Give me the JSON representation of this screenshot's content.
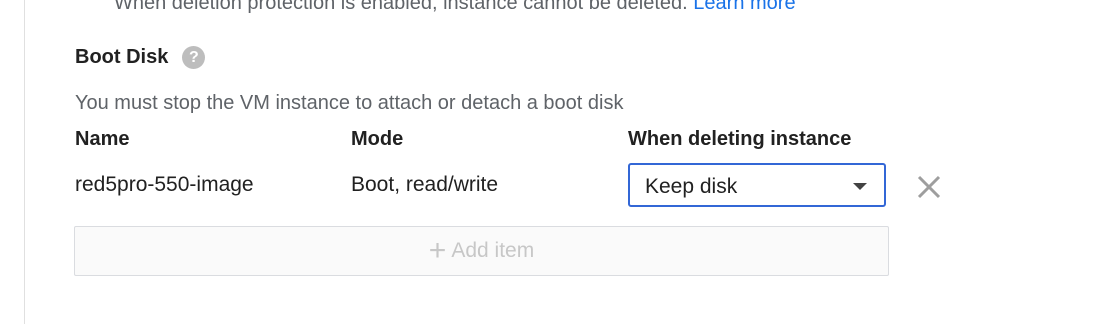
{
  "deletion_protection": {
    "text": "When deletion protection is enabled, instance cannot be deleted.",
    "link": "Learn more"
  },
  "boot_disk": {
    "title": "Boot Disk",
    "help_icon": "help-circle-icon",
    "hint": "You must stop the VM instance to attach or detach a boot disk",
    "columns": {
      "name": "Name",
      "mode": "Mode",
      "when_deleting": "When deleting instance"
    },
    "row": {
      "name": "red5pro-550-image",
      "mode": "Boot, read/write",
      "when_deleting": "Keep disk"
    },
    "remove_icon": "close-icon",
    "add_item": {
      "icon": "plus-icon",
      "label": "Add item"
    }
  },
  "colors": {
    "link": "#1a73e8",
    "select_border": "#3367d6",
    "disabled_text": "#c7c7c7"
  }
}
